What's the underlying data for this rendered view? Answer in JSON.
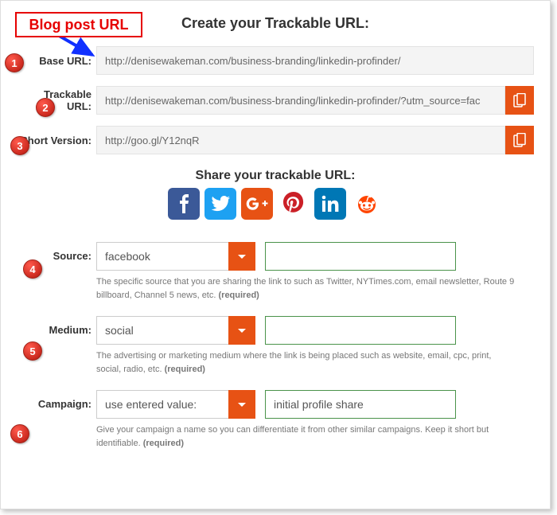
{
  "annotation": {
    "label": "Blog post URL"
  },
  "heading": "Create your Trackable URL:",
  "base": {
    "label": "Base URL:",
    "value": "http://denisewakeman.com/business-branding/linkedin-profinder/"
  },
  "trackable": {
    "label": "Trackable URL:",
    "value": "http://denisewakeman.com/business-branding/linkedin-profinder/?utm_source=fac"
  },
  "short": {
    "label": "Short Version:",
    "value": "http://goo.gl/Y12nqR"
  },
  "share_heading": "Share your trackable URL:",
  "share_icons": {
    "fb": "facebook-icon",
    "tw": "twitter-icon",
    "gp": "google-plus-icon",
    "pi": "pinterest-icon",
    "li": "linkedin-icon",
    "re": "reddit-icon"
  },
  "source": {
    "label": "Source:",
    "selected": "facebook",
    "extra": "",
    "help": "The specific source that you are sharing the link to such as Twitter, NYTimes.com, email newsletter, Route 9 billboard, Channel 5 news, etc.",
    "required": "(required)"
  },
  "medium": {
    "label": "Medium:",
    "selected": "social",
    "extra": "",
    "help": "The advertising or marketing medium where the link is being placed such as website, email, cpc, print, social, radio, etc.",
    "required": "(required)"
  },
  "campaign": {
    "label": "Campaign:",
    "selected": "use entered value:",
    "extra": "initial profile share",
    "help": "Give your campaign a name so you can differentiate it from other similar campaigns. Keep it short but identifiable.",
    "required": "(required)"
  },
  "badges": {
    "b1": "1",
    "b2": "2",
    "b3": "3",
    "b4": "4",
    "b5": "5",
    "b6": "6"
  }
}
